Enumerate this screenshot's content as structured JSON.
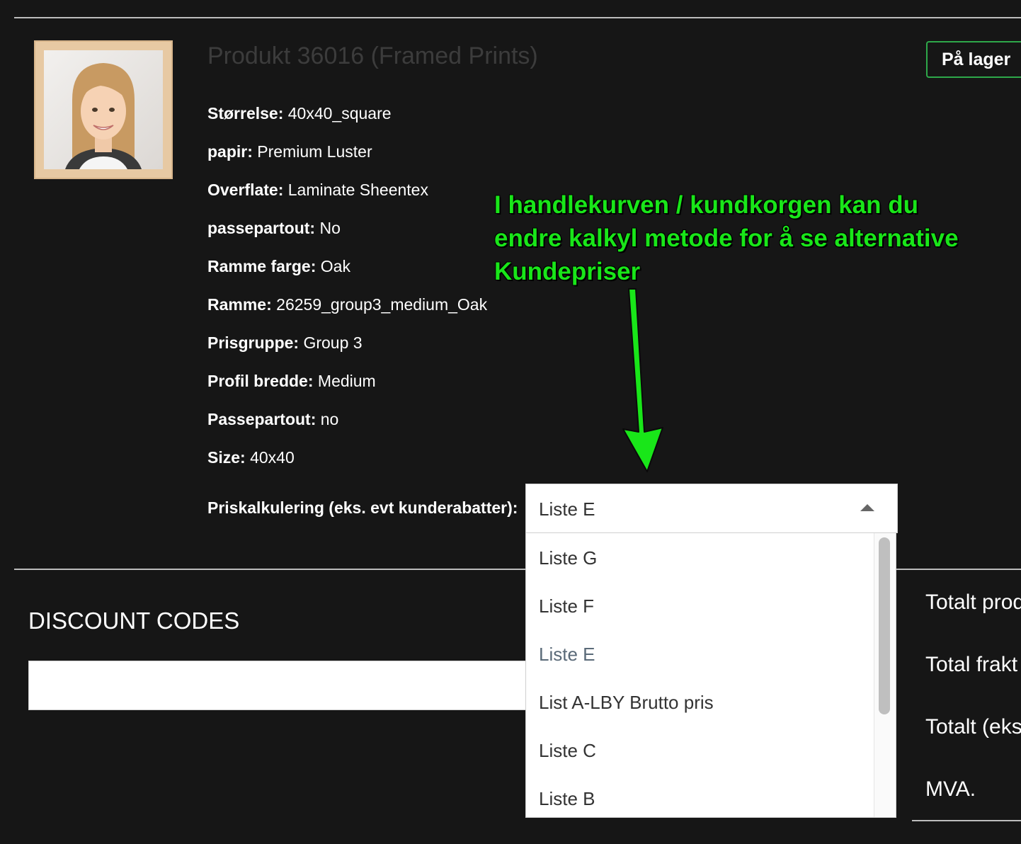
{
  "product": {
    "title": "Produkt 36016 (Framed Prints)",
    "stock": "På lager",
    "attributes": [
      {
        "label": "Størrelse:",
        "value": "40x40_square"
      },
      {
        "label": "papir:",
        "value": "Premium Luster"
      },
      {
        "label": "Overflate:",
        "value": "Laminate Sheentex"
      },
      {
        "label": "passepartout:",
        "value": "No"
      },
      {
        "label": "Ramme farge:",
        "value": "Oak"
      },
      {
        "label": "Ramme:",
        "value": "26259_group3_medium_Oak"
      },
      {
        "label": "Prisgruppe:",
        "value": "Group 3"
      },
      {
        "label": "Profil bredde:",
        "value": "Medium"
      },
      {
        "label": "Passepartout:",
        "value": "no"
      },
      {
        "label": "Size:",
        "value": "40x40"
      }
    ]
  },
  "pricing": {
    "label": "Priskalkulering (eks. evt kunderabatter):",
    "selected": "Liste E",
    "options": [
      "Liste G",
      "Liste F",
      "Liste E",
      "List A-LBY Brutto pris",
      "Liste C",
      "Liste B"
    ]
  },
  "discount": {
    "title": "DISCOUNT CODES",
    "value": ""
  },
  "totals": [
    "Totalt prod",
    "Total frakt",
    "Totalt (eks",
    "MVA."
  ],
  "annotation": {
    "lines": [
      "I handlekurven / kundkorgen kan du",
      "endre kalkyl metode for å se alternative",
      "Kundepriser"
    ]
  },
  "colors": {
    "background": "#161616",
    "stock_border": "#2ea84a",
    "annotation": "#19e619"
  },
  "icons": {
    "dropdown_caret": "caret-up-icon",
    "annotation_arrow": "arrow-down-icon"
  }
}
